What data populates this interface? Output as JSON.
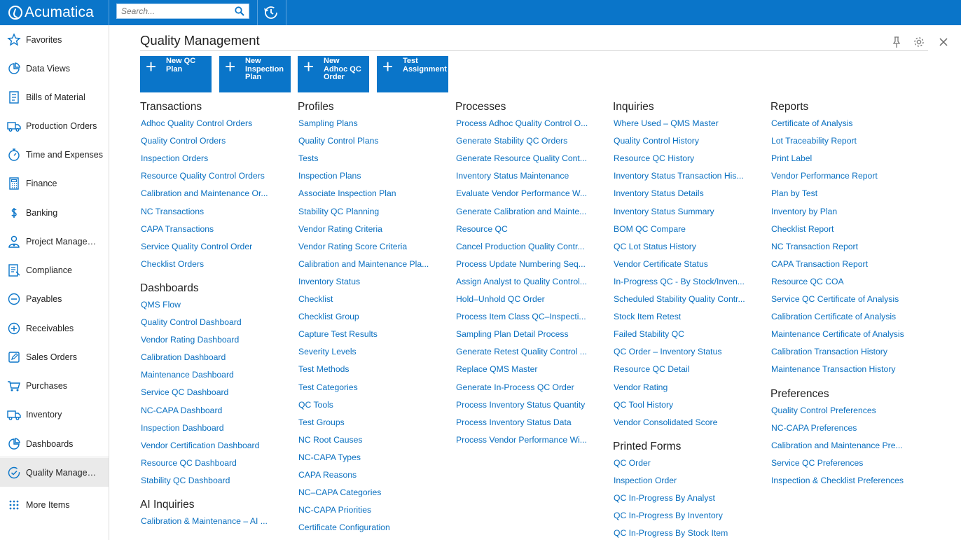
{
  "app": {
    "logo_text": "Acumatica"
  },
  "search": {
    "placeholder": "Search..."
  },
  "sidebar": {
    "items": [
      {
        "label": "Favorites",
        "icon": "star-icon"
      },
      {
        "label": "Data Views",
        "icon": "pie-chart-icon"
      },
      {
        "label": "Bills of Material",
        "icon": "bill-icon"
      },
      {
        "label": "Production Orders",
        "icon": "truck-icon"
      },
      {
        "label": "Time and Expenses",
        "icon": "stopwatch-icon"
      },
      {
        "label": "Finance",
        "icon": "calculator-icon"
      },
      {
        "label": "Banking",
        "icon": "dollar-icon"
      },
      {
        "label": "Project Management",
        "icon": "person-icon"
      },
      {
        "label": "Compliance",
        "icon": "document-icon"
      },
      {
        "label": "Payables",
        "icon": "minus-circle-icon"
      },
      {
        "label": "Receivables",
        "icon": "plus-circle-icon"
      },
      {
        "label": "Sales Orders",
        "icon": "pencil-icon"
      },
      {
        "label": "Purchases",
        "icon": "cart-icon"
      },
      {
        "label": "Inventory",
        "icon": "truck-icon"
      },
      {
        "label": "Dashboards",
        "icon": "pie-chart-icon"
      },
      {
        "label": "Quality Management",
        "icon": "check-circle-icon"
      }
    ],
    "more_label": "More Items"
  },
  "page": {
    "title": "Quality Management"
  },
  "tiles": [
    {
      "label": "New QC Plan"
    },
    {
      "label": "New Inspection Plan"
    },
    {
      "label": "New Adhoc QC Order"
    },
    {
      "label": "Test Assignment"
    }
  ],
  "columns": [
    {
      "sections": [
        {
          "heading": "Transactions",
          "links": [
            "Adhoc Quality Control Orders",
            "Quality Control Orders",
            "Inspection Orders",
            "Resource Quality Control Orders",
            "Calibration and Maintenance Or...",
            "NC Transactions",
            "CAPA Transactions",
            "Service Quality Control Order",
            "Checklist Orders"
          ]
        },
        {
          "heading": "Dashboards",
          "links": [
            "QMS Flow",
            "Quality Control Dashboard",
            "Vendor Rating Dashboard",
            "Calibration Dashboard",
            "Maintenance Dashboard",
            "Service QC Dashboard",
            "NC-CAPA Dashboard",
            "Inspection Dashboard",
            "Vendor Certification Dashboard",
            "Resource QC Dashboard",
            "Stability QC Dashboard"
          ]
        },
        {
          "heading": "AI Inquiries",
          "links": [
            "Calibration & Maintenance – AI ..."
          ]
        }
      ]
    },
    {
      "sections": [
        {
          "heading": "Profiles",
          "links": [
            "Sampling Plans",
            "Quality Control Plans",
            "Tests",
            "Inspection Plans",
            "Associate Inspection Plan",
            "Stability QC Planning",
            "Vendor Rating Criteria",
            "Vendor Rating Score Criteria",
            "Calibration and Maintenance Pla...",
            "Inventory Status",
            "Checklist",
            "Checklist Group",
            "Capture Test Results",
            "Severity Levels",
            "Test Methods",
            "Test Categories",
            "QC Tools",
            "Test Groups",
            "NC Root Causes",
            "NC-CAPA Types",
            "CAPA Reasons",
            "NC–CAPA Categories",
            "NC-CAPA Priorities",
            "Certificate Configuration"
          ]
        }
      ]
    },
    {
      "sections": [
        {
          "heading": "Processes",
          "links": [
            "Process Adhoc Quality Control O...",
            "Generate Stability QC Orders",
            "Generate Resource Quality Cont...",
            "Inventory Status Maintenance",
            "Evaluate Vendor Performance W...",
            "Generate Calibration and Mainte...",
            "Resource QC",
            "Cancel Production Quality Contr...",
            "Process Update Numbering Seq...",
            "Assign Analyst to Quality Control...",
            "Hold–Unhold QC Order",
            "Process Item Class QC–Inspecti...",
            "Sampling Plan Detail Process",
            "Generate Retest Quality Control ...",
            "Replace QMS Master",
            "Generate In-Process QC Order",
            "Process Inventory Status Quantity",
            "Process Inventory Status Data",
            "Process Vendor Performance Wi..."
          ]
        }
      ]
    },
    {
      "sections": [
        {
          "heading": "Inquiries",
          "links": [
            "Where Used – QMS Master",
            "Quality Control History",
            "Resource QC History",
            "Inventory Status Transaction His...",
            "Inventory Status Details",
            "Inventory Status Summary",
            "BOM QC Compare",
            "QC Lot Status History",
            "Vendor Certificate Status",
            "In-Progress QC - By Stock/Inven...",
            "Scheduled Stability Quality Contr...",
            "Stock Item Retest",
            "Failed Stability QC",
            "QC Order – Inventory Status",
            "Resource QC Detail",
            "Vendor Rating",
            "QC Tool History",
            "Vendor Consolidated Score"
          ]
        },
        {
          "heading": "Printed Forms",
          "links": [
            "QC Order",
            "Inspection Order",
            "QC In-Progress By Analyst",
            "QC In-Progress By Inventory",
            "QC In-Progress By Stock Item"
          ]
        }
      ]
    },
    {
      "sections": [
        {
          "heading": "Reports",
          "links": [
            "Certificate of Analysis",
            "Lot Traceability Report",
            "Print Label",
            "Vendor Performance Report",
            "Plan by Test",
            "Inventory by Plan",
            "Checklist Report",
            "NC Transaction Report",
            "CAPA Transaction Report",
            "Resource QC COA",
            "Service QC Certificate of Analysis",
            "Calibration Certificate of Analysis",
            "Maintenance Certificate of Analysis",
            "Calibration Transaction History",
            "Maintenance Transaction History"
          ]
        },
        {
          "heading": "Preferences",
          "links": [
            "Quality Control Preferences",
            "NC-CAPA Preferences",
            "Calibration and Maintenance Pre...",
            "Service QC Preferences",
            "Inspection & Checklist Preferences"
          ]
        }
      ]
    }
  ],
  "colors": {
    "brand": "#0a75c9",
    "link": "#0a70c0"
  }
}
